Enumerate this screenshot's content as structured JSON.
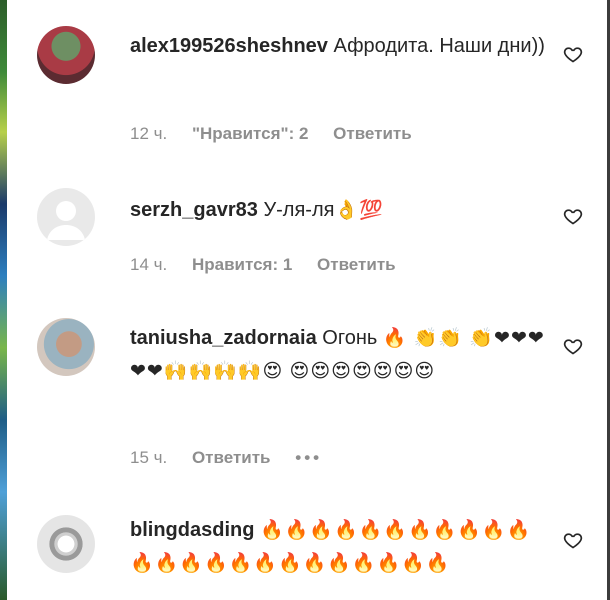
{
  "comments": [
    {
      "username": "alex199526sheshnev",
      "text": "Афродита. Наши дни))",
      "time": "12 ч.",
      "likes": "\"Нравится\": 2",
      "reply": "Ответить"
    },
    {
      "username": "serzh_gavr83",
      "text": "У-ля-ля",
      "emoji": "👌💯",
      "time": "14 ч.",
      "likes": "Нравится: 1",
      "reply": "Ответить"
    },
    {
      "username": "taniusha_zadornaia",
      "text": "Огонь",
      "emoji": "🔥 👏👏 👏❤❤❤❤❤🙌🙌🙌🙌😍 😍😍😍😍😍😍😍",
      "time": "15 ч.",
      "reply": "Ответить",
      "more": "•••"
    },
    {
      "username": "blingdasding",
      "emoji": "🔥🔥🔥🔥🔥🔥🔥🔥🔥🔥🔥🔥🔥🔥🔥🔥🔥🔥🔥🔥🔥🔥🔥🔥"
    }
  ],
  "icons": {
    "heart": "heart-icon",
    "avatar_placeholder": "person-silhouette-icon"
  }
}
